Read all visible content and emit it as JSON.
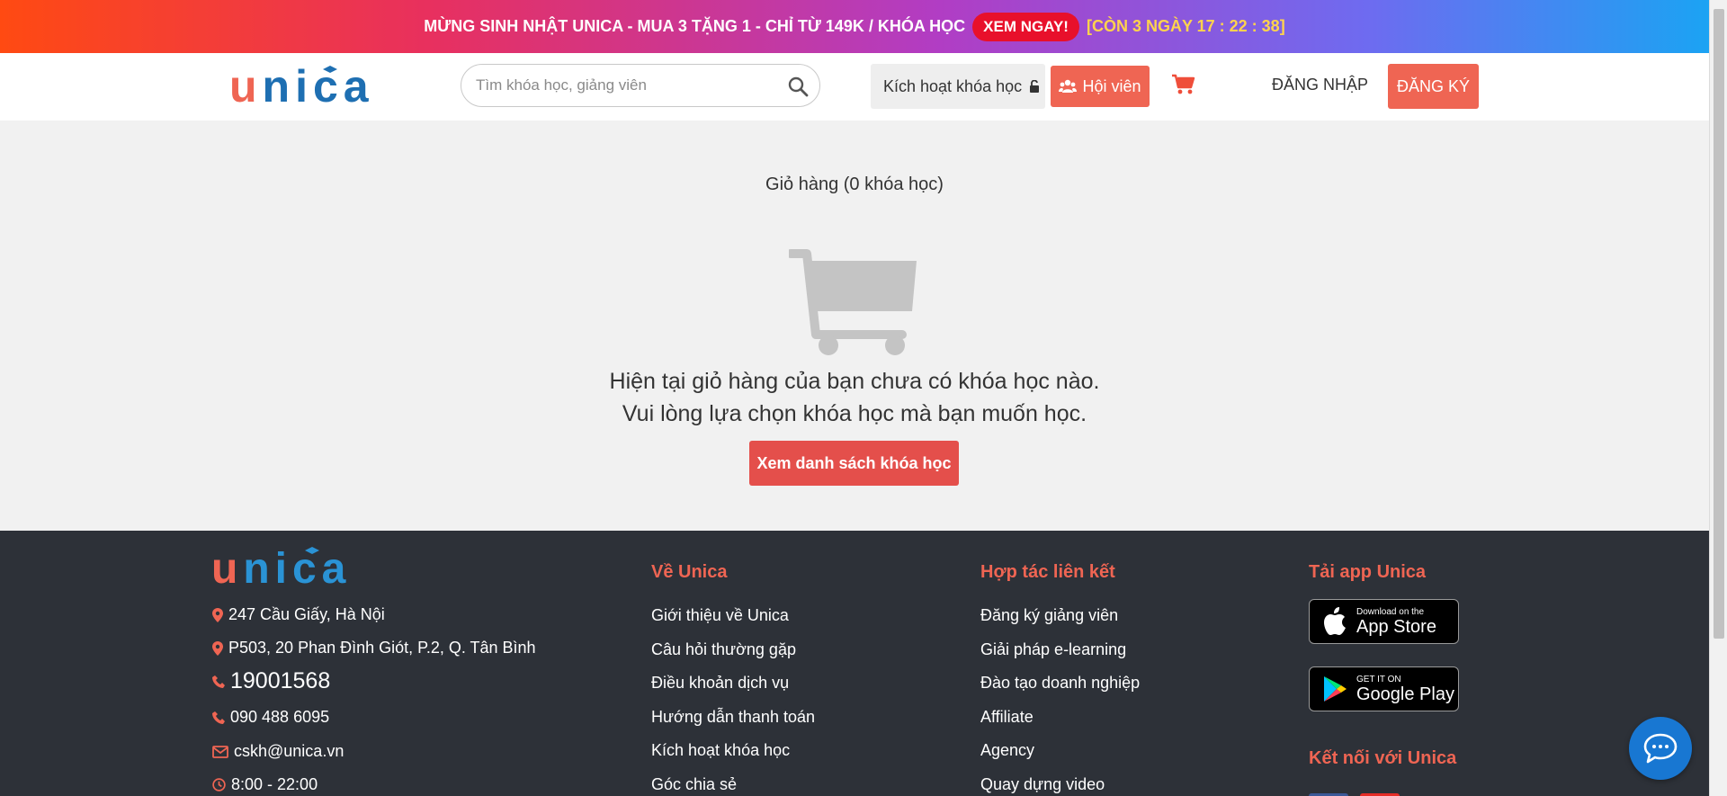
{
  "promo": {
    "text": "MỪNG SINH NHẬT UNICA - MUA 3 TẶNG 1 - CHỈ TỪ 149K / KHÓA HỌC",
    "cta": "XEM NGAY!",
    "countdown": "[CÒN 3 NGÀY 17 : 22 : 38]"
  },
  "header": {
    "logo_text": "unica",
    "search_placeholder": "Tìm khóa học, giảng viên",
    "activate": "Kích hoạt khóa học",
    "member": "Hội viên",
    "login": "ĐĂNG NHẬP",
    "register": "ĐĂNG KÝ"
  },
  "cart": {
    "title": "Giỏ hàng (0 khóa học)",
    "empty_line1": "Hiện tại giỏ hàng của bạn chưa có khóa học nào.",
    "empty_line2": "Vui lòng lựa chọn khóa học mà bạn muốn học.",
    "browse_button": "Xem danh sách khóa học"
  },
  "footer": {
    "logo_text": "unica",
    "contact": {
      "address1": "247 Cầu Giấy, Hà Nội",
      "address2": "P503, 20 Phan Đình Giót, P.2, Q. Tân Bình",
      "hotline": "19001568",
      "phone": "090 488 6095",
      "email": "cskh@unica.vn",
      "hours": "8:00 - 22:00"
    },
    "about": {
      "title": "Về Unica",
      "links": [
        "Giới thiệu về Unica",
        "Câu hỏi thường gặp",
        "Điều khoản dịch vụ",
        "Hướng dẫn thanh toán",
        "Kích hoạt khóa học",
        "Góc chia sẻ"
      ]
    },
    "partner": {
      "title": "Hợp tác liên kết",
      "links": [
        "Đăng ký giảng viên",
        "Giải pháp e-learning",
        "Đào tạo doanh nghiệp",
        "Affiliate",
        "Agency",
        "Quay dựng video"
      ]
    },
    "app": {
      "title": "Tải app Unica",
      "appstore_small": "Download on the",
      "appstore_large": "App Store",
      "googleplay_small": "GET IT ON",
      "googleplay_large": "Google Play",
      "connect_title": "Kết nối với Unica"
    }
  },
  "colors": {
    "accent": "#ef6553",
    "logo_blue": "#1e6fb2",
    "footer_bg": "#2d3138",
    "chat_blue": "#1877d2"
  }
}
